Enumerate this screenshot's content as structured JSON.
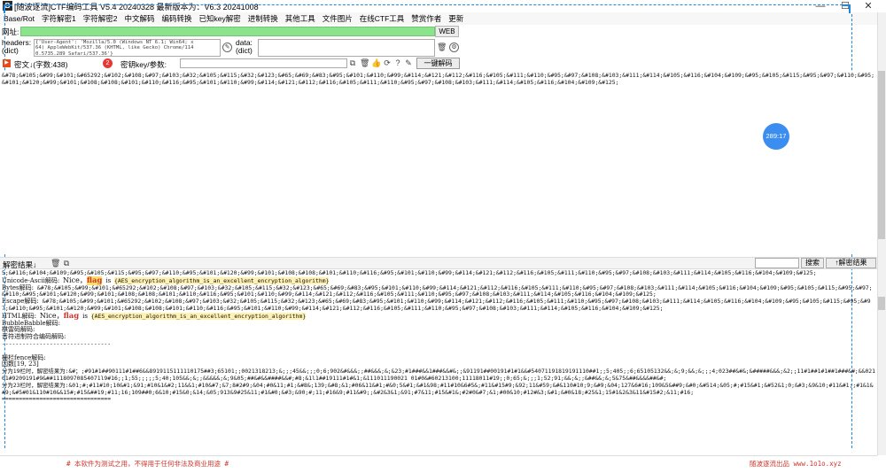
{
  "window": {
    "icon_text": "B",
    "title": "[随波逐流]CTF编码工具 V5.4 20240328     最新版本为：V6.3 20241008",
    "min_label": "—",
    "max_label": "☐",
    "close_label": "✕"
  },
  "menu": [
    "Base/Rot",
    "字符解密1",
    "字符解密2",
    "中文解码",
    "编码转换",
    "已知key解密",
    "进制转换",
    "其他工具",
    "文件图片",
    "在线CTF工具",
    "赞赏作者",
    "更新"
  ],
  "url_row": {
    "label": "网址:",
    "value": "",
    "button": "WEB"
  },
  "headers_row": {
    "label": "headers:\n(dict)",
    "value": "{'User-Agent': 'Mozilla/5.0 (Windows NT 6.1; Win64; x\n64) AppleWebKit/537.36 (KHTML, like Gecko) Chrome/114\n0.5735.289 Safari/537.36'}",
    "data_label": "data:\n(dict)",
    "data_value": ""
  },
  "key_row": {
    "cipher_label": "密文↓(字数:438)",
    "key_label": "密钥key/参数:",
    "key_value": "",
    "button": "一键解码"
  },
  "input_text": "&#78;&#105;&#99;&#101;&#65292;&#102;&#108;&#97;&#103;&#32;&#105;&#115;&#32;&#123;&#65;&#69;&#83;&#95;&#101;&#110;&#99;&#114;&#121;&#112;&#116;&#105;&#111;&#110;&#95;&#97;&#108;&#103;&#111;&#114;&#105;&#116;&#104;&#109;&#95;&#105;&#115;&#95;&#97;&#110;&#95;&#101;&#120;&#99;&#101;&#108;&#108;&#101;&#110;&#116;&#95;&#101;&#110;&#99;&#114;&#121;&#112;&#116;&#105;&#111;&#110;&#95;&#97;&#108;&#103;&#111;&#114;&#105;&#116;&#104;&#109;&#125;",
  "badge": "289:17",
  "split_bar": {
    "result_label": "解密结果↓",
    "search_button": "搜索",
    "decode_button": "↑解密结果"
  },
  "output": {
    "line_top": "5;&#116;&#104;&#109;&#95;&#105;&#115;&#95;&#97;&#110;&#95;&#101;&#120;&#99;&#101;&#108;&#108;&#101;&#110;&#116;&#95;&#101;&#110;&#99;&#114;&#121;&#112;&#116;&#105;&#111;&#110;&#95;&#97;&#108;&#103;&#111;&#114;&#105;&#116;&#104;&#109;&#125;",
    "unicode_label": "Unicode-Ascii解码:",
    "nice": "Nice，",
    "flag": "flag",
    "is": "is",
    "flag_value": "{AES_encryption_algorithm_is_an_excellent_encryption_algorithm}",
    "bytes_label": "Bytes解码:",
    "bytes_value": "&#78;&#105;&#99;&#101;&#65292;&#102;&#108;&#97;&#103;&#32;&#105;&#115;&#32;&#123;&#65;&#69;&#83;&#95;&#101;&#110;&#99;&#114;&#121;&#112;&#116;&#105;&#111;&#110;&#95;&#97;&#108;&#103;&#111;&#114;&#105;&#116;&#104;&#109;&#95;&#105;&#115;&#95;&#97;&#110;&#95;&#101;&#120;&#99;&#101;&#108;&#108;&#101;&#110;&#116;&#95;&#101;&#110;&#99;&#114;&#121;&#112;&#116;&#105;&#111;&#110;&#95;&#97;&#108;&#103;&#111;&#114;&#105;&#116;&#104;&#109;&#125;",
    "escape_label": "Escape解码:",
    "escape_value": "&#78;&#105;&#99;&#101;&#65292;&#102;&#108;&#97;&#103;&#32;&#105;&#115;&#32;&#123;&#65;&#69;&#83;&#95;&#101;&#110;&#99;&#114;&#121;&#112;&#116;&#105;&#111;&#110;&#95;&#97;&#108;&#103;&#111;&#114;&#105;&#116;&#104;&#109;&#95;&#105;&#115;&#95;&#97;&#110;&#95;&#101;&#120;&#99;&#101;&#108;&#108;&#101;&#110;&#116;&#95;&#101;&#110;&#99;&#114;&#121;&#112;&#116;&#105;&#111;&#110;&#95;&#97;&#108;&#103;&#111;&#114;&#105;&#116;&#104;&#109;&#125;",
    "html_label": "HTML解码:",
    "bubble": "BubbleBabble解码:",
    "leidou": "棋雷码解码:",
    "yinyue": "音符进制符合编码解码:",
    "dashes": "--------------------------------",
    "blank": "",
    "fence_label": "栅栏fence解码:",
    "factor": "因数[19, 23]",
    "fence19": "分为19栏时，解密结果为:&#；;#91#1##90111#1##6&&8919115111110175##3;65101;;0021318213;&;;;45&&;;;0;6;902&#&&&;;##&&&;&;&23;#1###&&1###&&#&;;&91191##00191#1#1&&#54071191819191110##1;;5;405;;6;65105132&&;&;9;&&;&;;;4;023##&#&;&#####&&&;&2;;11#1##1#1##1###&#;&&02101#9209191#9&##11180970854071l9#16;;1;55;;;;;5;40;105&&;&;;&&&&&;&;9&05;##&#&&####&&#;#8;&1l1##19111#1#&1;&111011190021 01#0&#60213100;11118011#19;;0;65;&;;;1;52;91;&&;&;;&##&&;&;5&75&##&&&&##&#;",
    "fence23": "分为23栏时，解密结果为:&01;#;#11#10;10&#1;&91;#10&1&#2;11&&1;#10&#7;&7;8#2#9;&04;#0&11;#1;&#8&;139;&#8;&1;#06&11&#1;#&0;5&#1;&#1&98;#11#10&6#5&;#11&#15#9;&92;11&#59;&#&110#10;9;&#9;&04;127&6#16;109&5&##9;&#0;&#514;&05;#;#15&#1;&#52&1;0;&#3;&9&10;#11&#1;;#1&1&#9;&#5#01&110#10&&15#;#15&##19;#11;16;109##0;6&10;#15&0;&14;&05;913&9#25&11;#1&#0;&#3;&90;#;11;#16&9;#11&#9;;&#2&3&1;&91;#7&11;#15&#1&;#2#0&#7;&1;#00&10;#12#&3;&#1;&#0&18;#25&1;15#1&2&3&11&#15#2;&11;#16;",
    "equals": "================================"
  },
  "status": {
    "left": "# 本软件为测试之用，不得用于任何非法及商业用途 #",
    "right": "随波逐流出品 www.1o1o.xyz"
  },
  "colors": {
    "url_bg": "#8be38b",
    "flag_red": "#d0342c",
    "badge_blue": "#3b8ef0",
    "accent_blue": "#1e88e5"
  }
}
